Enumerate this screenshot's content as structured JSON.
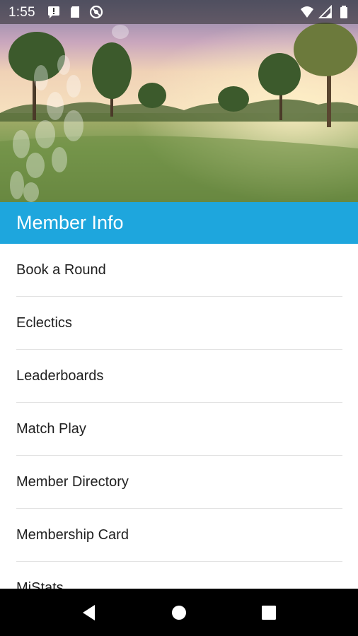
{
  "status_bar": {
    "time": "1:55",
    "left_icons": [
      "message-alert-icon",
      "sd-card-icon",
      "do-not-disturb-icon"
    ],
    "right_icons": [
      "wifi-icon",
      "cell-signal-icon",
      "battery-icon"
    ]
  },
  "hero": {
    "image": "golf-course-sunrise"
  },
  "header": {
    "title": "Member Info",
    "color": "#1ea6dd"
  },
  "menu": {
    "items": [
      {
        "label": "Book a Round"
      },
      {
        "label": "Eclectics"
      },
      {
        "label": "Leaderboards"
      },
      {
        "label": "Match Play"
      },
      {
        "label": "Member Directory"
      },
      {
        "label": "Membership Card"
      },
      {
        "label": "MiStats"
      }
    ]
  },
  "nav_bar": {
    "buttons": [
      "back-icon",
      "home-icon",
      "recents-icon"
    ]
  }
}
